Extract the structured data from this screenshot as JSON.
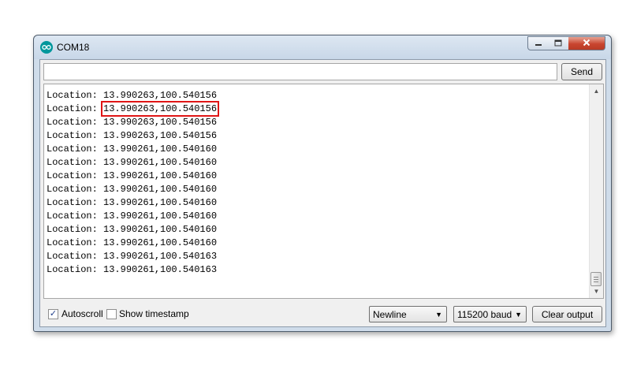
{
  "window": {
    "title": "COM18",
    "app_icon": "arduino-icon",
    "controls": [
      "minimize-icon",
      "maximize-icon",
      "close-icon"
    ]
  },
  "send_bar": {
    "input_value": "",
    "send_label": "Send"
  },
  "output": {
    "prefix": "Location: ",
    "lines": [
      "13.990263,100.540156",
      "13.990263,100.540156",
      "13.990263,100.540156",
      "13.990263,100.540156",
      "13.990261,100.540160",
      "13.990261,100.540160",
      "13.990261,100.540160",
      "13.990261,100.540160",
      "13.990261,100.540160",
      "13.990261,100.540160",
      "13.990261,100.540160",
      "13.990261,100.540160",
      "13.990261,100.540163",
      "13.990261,100.540163"
    ],
    "highlighted_line": 1,
    "highlight_color": "#e01515"
  },
  "bottom_bar": {
    "autoscroll_label": "Autoscroll",
    "autoscroll_checked": true,
    "timestamp_label": "Show timestamp",
    "timestamp_checked": false,
    "line_ending": "Newline",
    "baud_rate": "115200 baud",
    "clear_label": "Clear output"
  }
}
